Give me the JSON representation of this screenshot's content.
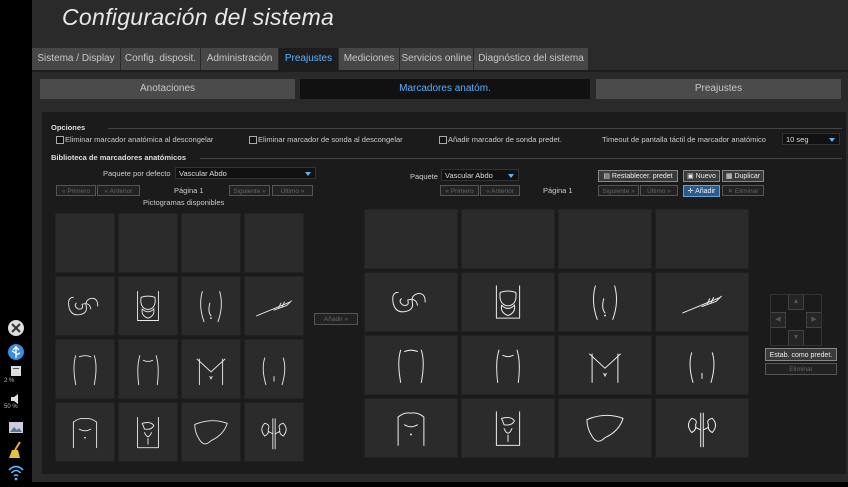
{
  "title": "Configuración del sistema",
  "tabs": [
    "Sistema / Display",
    "Config. disposit.",
    "Administración",
    "Preajustes",
    "Mediciones",
    "Servicios online",
    "Diagnóstico del sistema"
  ],
  "subtabs": [
    "Anotaciones",
    "Marcadores anatóm.",
    "Preajustes"
  ],
  "sidebar": {
    "printer_pct": "2 %",
    "volume_pct": "50 %"
  },
  "options": {
    "header": "Opciones",
    "opt1": "Eliminar marcador anatómica al descongelar",
    "opt2": "Eliminar marcador de sonda al descongelar",
    "opt3": "Añadir marcador de sonda predet.",
    "timeout_label": "Timeout de pantalla táctil de marcador anatómico",
    "timeout_value": "10 seg"
  },
  "library": {
    "header": "Biblioteca de marcadores anatómicos",
    "default_pkg_label": "Paquete por defecto",
    "default_pkg_value": "Vascular Abdo",
    "pkg_label": "Paquete",
    "pkg_value": "Vascular Abdo",
    "first": "Primero",
    "prev": "Anterior",
    "next": "Siguiente",
    "last": "Último",
    "page_left": "Página 1",
    "page_right": "Página 1",
    "available": "Pictogramas disponibles",
    "add_center": "Añadir",
    "reset": "Restablecer. predet",
    "new": "Nuevo",
    "duplicate": "Duplicar",
    "add": "Añadir",
    "delete_top": "Eliminar",
    "set_default": "Estab. como predet.",
    "delete": "Eliminar"
  }
}
